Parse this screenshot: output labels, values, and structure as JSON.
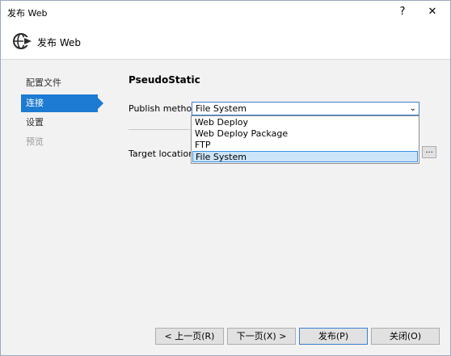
{
  "window": {
    "title": "发布 Web",
    "help_label": "?",
    "close_label": "✕"
  },
  "header": {
    "title": "发布 Web",
    "icon": "globe-publish-icon"
  },
  "nav": {
    "items": [
      {
        "label": "配置文件",
        "state": "normal"
      },
      {
        "label": "连接",
        "state": "selected"
      },
      {
        "label": "设置",
        "state": "normal"
      },
      {
        "label": "预览",
        "state": "disabled"
      }
    ]
  },
  "connection": {
    "profile_name": "PseudoStatic",
    "publish_method_label": "Publish method:",
    "publish_method_value": "File System",
    "options": [
      "Web Deploy",
      "Web Deploy Package",
      "FTP",
      "File System"
    ],
    "highlighted_option": "File System",
    "target_location_label": "Target location:",
    "browse_label": "..."
  },
  "footer": {
    "prev_label": "< 上一页(R)",
    "next_label": "下一页(X) >",
    "publish_label": "发布(P)",
    "close_label": "关闭(O)"
  },
  "colors": {
    "accent": "#1e7bd3",
    "highlight": "#cce4f7",
    "panel_bg": "#f2f2f2"
  }
}
